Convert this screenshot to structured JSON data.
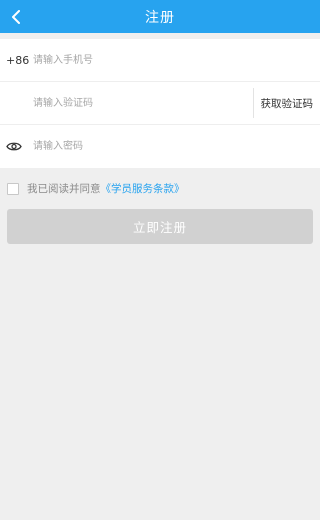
{
  "header": {
    "title": "注册",
    "back_icon": "chevron-left-icon"
  },
  "form": {
    "phone": {
      "prefix": "+86",
      "placeholder": "请输入手机号",
      "value": ""
    },
    "code": {
      "placeholder": "请输入验证码",
      "value": "",
      "button_label": "获取验证码"
    },
    "password": {
      "icon": "eye-icon",
      "placeholder": "请输入密码",
      "value": ""
    }
  },
  "agreement": {
    "checked": false,
    "text": "我已阅读并同意",
    "link_text": "《学员服务条款》"
  },
  "submit": {
    "label": "立即注册"
  },
  "colors": {
    "primary": "#27a3ef",
    "background": "#efefef",
    "button_disabled": "#d1d1d1",
    "placeholder": "#a6a6a6"
  }
}
